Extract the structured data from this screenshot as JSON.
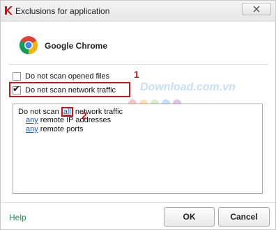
{
  "window": {
    "title": "Exclusions for application",
    "close_icon": "close-x-icon"
  },
  "app": {
    "name": "Google Chrome",
    "icon": "chrome-icon"
  },
  "options": [
    {
      "label": "Do not scan opened files",
      "checked": false
    },
    {
      "label": "Do not scan network traffic",
      "checked": true
    }
  ],
  "rules": {
    "line1_prefix": "Do not scan ",
    "line1_link": "all",
    "line1_suffix": " network traffic",
    "line2_link": "any",
    "line2_suffix": " remote IP addresses",
    "line3_link": "any",
    "line3_suffix": " remote ports"
  },
  "annotations": {
    "marker1": "1",
    "marker2": "2",
    "color": "#c4161c"
  },
  "watermark": {
    "text": "Download.com.vn"
  },
  "footer": {
    "help": "Help",
    "ok": "OK",
    "cancel": "Cancel"
  },
  "colors": {
    "link": "#1a56c8",
    "help": "#2e8b57"
  }
}
